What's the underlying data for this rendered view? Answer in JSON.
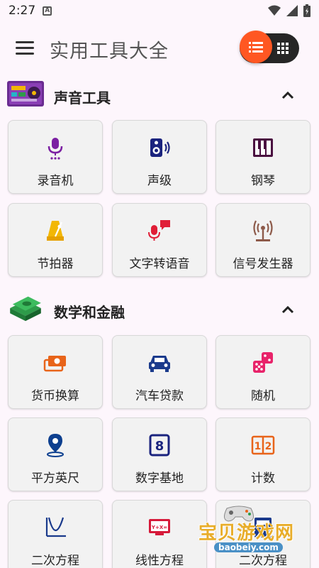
{
  "status": {
    "time": "2:27",
    "indicator": "A"
  },
  "app": {
    "title": "实用工具大全"
  },
  "sections": [
    {
      "title": "声音工具",
      "tools": [
        {
          "label": "录音机",
          "icon": "microphone-icon",
          "color": "#7b1fa2"
        },
        {
          "label": "声级",
          "icon": "speaker-icon",
          "color": "#1a237e"
        },
        {
          "label": "钢琴",
          "icon": "piano-icon",
          "color": "#4a1040"
        },
        {
          "label": "节拍器",
          "icon": "metronome-icon",
          "color": "#f2b705"
        },
        {
          "label": "文字转语音",
          "icon": "text-to-speech-icon",
          "color": "#e01e37"
        },
        {
          "label": "信号发生器",
          "icon": "signal-tower-icon",
          "color": "#8d5a4a"
        }
      ]
    },
    {
      "title": "数学和金融",
      "tools": [
        {
          "label": "货币换算",
          "icon": "banknote-icon",
          "color": "#e8641a"
        },
        {
          "label": "汽车贷款",
          "icon": "car-icon",
          "color": "#1a3a8c"
        },
        {
          "label": "随机",
          "icon": "dice-icon",
          "color": "#e8236a"
        },
        {
          "label": "平方英尺",
          "icon": "location-pin-icon",
          "color": "#0d3f8f"
        },
        {
          "label": "数字基地",
          "icon": "number-box-icon",
          "color": "#1a237e"
        },
        {
          "label": "计数",
          "icon": "counter-icon",
          "color": "#e8641a"
        },
        {
          "label": "二次方程",
          "icon": "parabola-graph-icon",
          "color": "#1a3a8c"
        },
        {
          "label": "线性方程",
          "icon": "linear-equation-icon",
          "color": "#d61a3a"
        },
        {
          "label": "二次方程",
          "icon": "equation-icon",
          "color": "#1a3a8c"
        }
      ]
    }
  ],
  "watermark": {
    "text": "宝贝游戏网",
    "url": "baobeiy.com"
  }
}
